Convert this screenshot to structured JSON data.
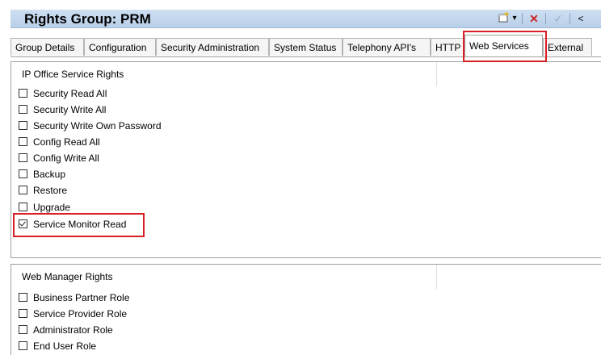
{
  "header": {
    "label": "Rights Group:",
    "name": "PRM",
    "tools": {
      "new_icon": "new-item-icon",
      "dropdown_icon": "▾",
      "delete_icon": "✕",
      "ok_icon": "✓",
      "back_icon": "<"
    }
  },
  "tabs": [
    {
      "label": "Group Details"
    },
    {
      "label": "Configuration"
    },
    {
      "label": "Security Administration"
    },
    {
      "label": "System Status"
    },
    {
      "label": "Telephony API's"
    },
    {
      "label": "HTTP"
    },
    {
      "label": "Web Services",
      "active": true
    },
    {
      "label": "External"
    }
  ],
  "ip_office": {
    "title": "IP Office Service Rights",
    "items": [
      {
        "label": "Security Read All",
        "checked": false
      },
      {
        "label": "Security Write All",
        "checked": false
      },
      {
        "label": "Security Write Own Password",
        "checked": false
      },
      {
        "label": "Config Read All",
        "checked": false
      },
      {
        "label": "Config Write All",
        "checked": false
      },
      {
        "label": "Backup",
        "checked": false
      },
      {
        "label": "Restore",
        "checked": false
      },
      {
        "label": "Upgrade",
        "checked": false
      },
      {
        "label": "Service Monitor Read",
        "checked": true
      }
    ]
  },
  "web_manager": {
    "title": "Web Manager Rights",
    "items": [
      {
        "label": "Business Partner Role",
        "checked": false
      },
      {
        "label": "Service Provider Role",
        "checked": false
      },
      {
        "label": "Administrator Role",
        "checked": false
      },
      {
        "label": "End User Role",
        "checked": false
      }
    ]
  },
  "colors": {
    "highlight": "#d91f26",
    "header_bg": "#c4d7ee",
    "delete": "#d0212a"
  }
}
